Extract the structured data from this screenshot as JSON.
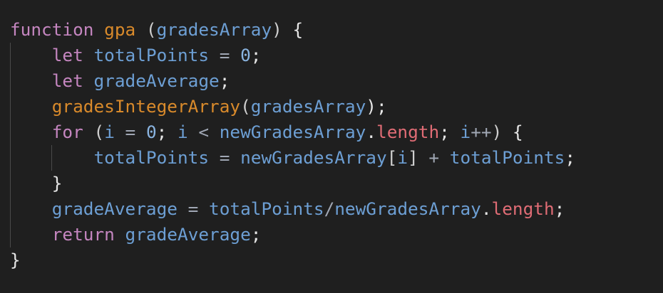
{
  "editor": {
    "colors": {
      "background": "#1f1f1f",
      "keyword": "#c586c0",
      "function": "#d98a2b",
      "variable": "#6d9fd4",
      "property": "#e06c75",
      "punctuation": "#e6e6e6"
    },
    "lines": [
      [
        {
          "t": "function",
          "c": "kw-decl"
        },
        {
          "t": " ",
          "c": "punc"
        },
        {
          "t": "gpa",
          "c": "fn"
        },
        {
          "t": " ",
          "c": "punc"
        },
        {
          "t": "(",
          "c": "paren"
        },
        {
          "t": "gradesArray",
          "c": "var"
        },
        {
          "t": ")",
          "c": "paren"
        },
        {
          "t": " {",
          "c": "punc"
        }
      ],
      [
        {
          "t": "    ",
          "c": "punc"
        },
        {
          "t": "let",
          "c": "kw-decl"
        },
        {
          "t": " ",
          "c": "punc"
        },
        {
          "t": "totalPoints",
          "c": "var"
        },
        {
          "t": " = ",
          "c": "op"
        },
        {
          "t": "0",
          "c": "num"
        },
        {
          "t": ";",
          "c": "punc"
        }
      ],
      [
        {
          "t": "    ",
          "c": "punc"
        },
        {
          "t": "let",
          "c": "kw-decl"
        },
        {
          "t": " ",
          "c": "punc"
        },
        {
          "t": "gradeAverage",
          "c": "var"
        },
        {
          "t": ";",
          "c": "punc"
        }
      ],
      [
        {
          "t": "    ",
          "c": "punc"
        },
        {
          "t": "gradesIntegerArray",
          "c": "fn"
        },
        {
          "t": "(",
          "c": "paren"
        },
        {
          "t": "gradesArray",
          "c": "var"
        },
        {
          "t": ");",
          "c": "punc"
        }
      ],
      [
        {
          "t": "    ",
          "c": "punc"
        },
        {
          "t": "for",
          "c": "kw-decl"
        },
        {
          "t": " ",
          "c": "punc"
        },
        {
          "t": "(",
          "c": "paren"
        },
        {
          "t": "i",
          "c": "var"
        },
        {
          "t": " = ",
          "c": "op"
        },
        {
          "t": "0",
          "c": "num"
        },
        {
          "t": "; ",
          "c": "punc"
        },
        {
          "t": "i",
          "c": "var"
        },
        {
          "t": " < ",
          "c": "op"
        },
        {
          "t": "newGradesArray",
          "c": "var"
        },
        {
          "t": ".",
          "c": "punc"
        },
        {
          "t": "length",
          "c": "prop"
        },
        {
          "t": "; ",
          "c": "punc"
        },
        {
          "t": "i",
          "c": "var"
        },
        {
          "t": "++",
          "c": "op"
        },
        {
          "t": ")",
          "c": "paren"
        },
        {
          "t": " {",
          "c": "punc"
        }
      ],
      [
        {
          "t": "        ",
          "c": "punc"
        },
        {
          "t": "totalPoints",
          "c": "var"
        },
        {
          "t": " = ",
          "c": "op"
        },
        {
          "t": "newGradesArray",
          "c": "var"
        },
        {
          "t": "[",
          "c": "paren"
        },
        {
          "t": "i",
          "c": "var"
        },
        {
          "t": "]",
          "c": "paren"
        },
        {
          "t": " + ",
          "c": "op"
        },
        {
          "t": "totalPoints",
          "c": "var"
        },
        {
          "t": ";",
          "c": "punc"
        }
      ],
      [
        {
          "t": "    ",
          "c": "punc"
        },
        {
          "t": "}",
          "c": "punc"
        }
      ],
      [
        {
          "t": "    ",
          "c": "punc"
        },
        {
          "t": "gradeAverage",
          "c": "var"
        },
        {
          "t": " = ",
          "c": "op"
        },
        {
          "t": "totalPoints",
          "c": "var"
        },
        {
          "t": "/",
          "c": "op"
        },
        {
          "t": "newGradesArray",
          "c": "var"
        },
        {
          "t": ".",
          "c": "punc"
        },
        {
          "t": "length",
          "c": "prop"
        },
        {
          "t": ";",
          "c": "punc"
        }
      ],
      [
        {
          "t": "    ",
          "c": "punc"
        },
        {
          "t": "return",
          "c": "kw-decl"
        },
        {
          "t": " ",
          "c": "punc"
        },
        {
          "t": "gradeAverage",
          "c": "var"
        },
        {
          "t": ";",
          "c": "punc"
        }
      ],
      [
        {
          "t": "}",
          "c": "punc"
        }
      ]
    ]
  }
}
